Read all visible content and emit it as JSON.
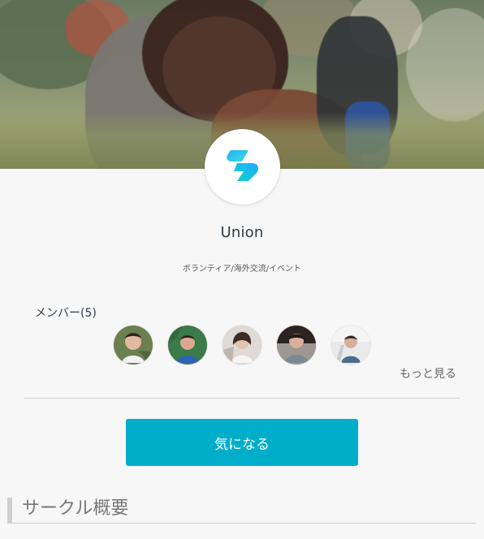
{
  "header": {
    "image_alt": "Child being held"
  },
  "circle": {
    "name": "Union",
    "tags": "ボランティア/海外交流/イベント",
    "logo_icon": "union-logo-icon",
    "accent": "#00aeca"
  },
  "members": {
    "label": "メンバー(5)",
    "avatars": [
      {
        "icon": "member-avatar-1"
      },
      {
        "icon": "member-avatar-2"
      },
      {
        "icon": "member-avatar-3"
      },
      {
        "icon": "member-avatar-4"
      },
      {
        "icon": "member-avatar-5"
      }
    ],
    "more_label": "もっと見る"
  },
  "actions": {
    "interest_label": "気になる"
  },
  "overview": {
    "title": "サークル概要"
  }
}
